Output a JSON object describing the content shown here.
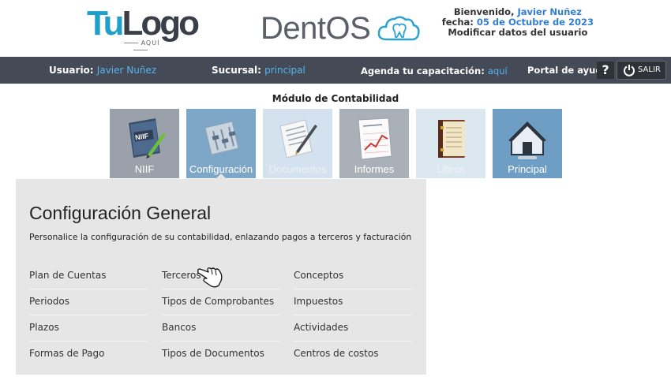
{
  "header": {
    "logo": {
      "main_tu": "Tu",
      "main_rest": "Logo",
      "sub": "AQUÍ"
    },
    "brand": {
      "name_a": "Dent",
      "name_b": "OS"
    },
    "welcome": {
      "greeting_label": "Bienvenido,",
      "user_name": "Javier Nuñez",
      "date_label": "fecha:",
      "date_value": "05 de Octubre de 2023",
      "edit_link": "Modificar datos del usuario"
    }
  },
  "navbar": {
    "user_label": "Usuario:",
    "user_value": "Javier Nuñez",
    "branch_label": "Sucursal:",
    "branch_value": "principal",
    "training_label": "Agenda tu capacitación:",
    "training_link": "aquí",
    "help_label": "Portal de ayuda",
    "help_icon": "?",
    "logout_label": "SALIR"
  },
  "module_title": "Módulo de Contabilidad",
  "tiles": [
    {
      "label": "NIIF",
      "icon": "book-pen-icon"
    },
    {
      "label": "Configuración",
      "icon": "settings-sliders-icon"
    },
    {
      "label": "Documentos",
      "icon": "document-pen-icon"
    },
    {
      "label": "Informes",
      "icon": "report-chart-icon"
    },
    {
      "label": "Libros",
      "icon": "ledger-book-icon"
    },
    {
      "label": "Principal",
      "icon": "home-icon"
    }
  ],
  "active_tile": "Configuración",
  "panel": {
    "title": "Configuración General",
    "description": "Personalice la configuración de su contabilidad, enlazando pagos a terceros y facturación",
    "links": [
      [
        "Plan de Cuentas",
        "Terceros",
        "Conceptos"
      ],
      [
        "Periodos",
        "Tipos de Comprobantes",
        "Impuestos"
      ],
      [
        "Plazos",
        "Bancos",
        "Actividades"
      ],
      [
        "Formas de Pago",
        "Tipos de Documentos",
        "Centros de costos"
      ]
    ]
  },
  "colors": {
    "navbar_bg": "#444b56",
    "link_blue": "#58b3f0",
    "logo_blue": "#1fa0c9",
    "panel_bg": "#e6e6e6",
    "active_tile_bg": "#7ea6c6"
  }
}
